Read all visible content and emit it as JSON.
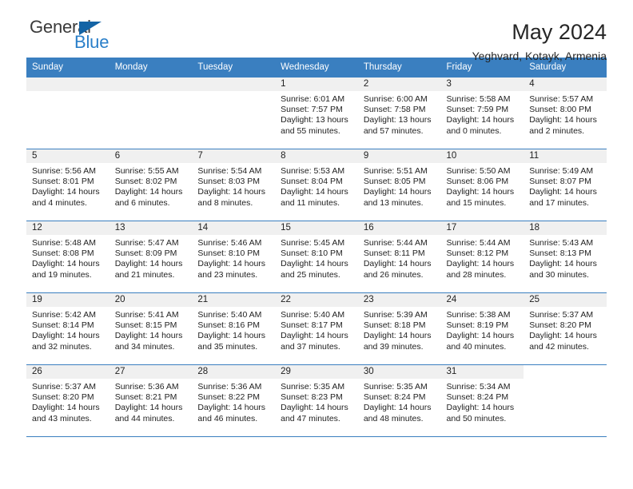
{
  "logo": {
    "word_one": "General",
    "word_two": "Blue",
    "triangle_color": "#1464a5",
    "blue_color": "#2a7fc9"
  },
  "header": {
    "title": "May 2024",
    "subtitle": "Yeghvard, Kotayk, Armenia"
  },
  "colors": {
    "header_band": "#3a7fc0",
    "daynum_band": "#f0f0f0",
    "text": "#1f1f1f"
  },
  "calendar": {
    "weekday_headers": [
      "Sunday",
      "Monday",
      "Tuesday",
      "Wednesday",
      "Thursday",
      "Friday",
      "Saturday"
    ],
    "labels": {
      "sunrise": "Sunrise:",
      "sunset": "Sunset:",
      "daylight": "Daylight:"
    },
    "weeks": [
      [
        {
          "day": "",
          "blank": false,
          "sunrise": "",
          "sunset": "",
          "daylight_1": "",
          "daylight_2": ""
        },
        {
          "day": "",
          "blank": false,
          "sunrise": "",
          "sunset": "",
          "daylight_1": "",
          "daylight_2": ""
        },
        {
          "day": "",
          "blank": false,
          "sunrise": "",
          "sunset": "",
          "daylight_1": "",
          "daylight_2": ""
        },
        {
          "day": "1",
          "blank": false,
          "sunrise": "Sunrise: 6:01 AM",
          "sunset": "Sunset: 7:57 PM",
          "daylight_1": "Daylight: 13 hours",
          "daylight_2": "and 55 minutes."
        },
        {
          "day": "2",
          "blank": false,
          "sunrise": "Sunrise: 6:00 AM",
          "sunset": "Sunset: 7:58 PM",
          "daylight_1": "Daylight: 13 hours",
          "daylight_2": "and 57 minutes."
        },
        {
          "day": "3",
          "blank": false,
          "sunrise": "Sunrise: 5:58 AM",
          "sunset": "Sunset: 7:59 PM",
          "daylight_1": "Daylight: 14 hours",
          "daylight_2": "and 0 minutes."
        },
        {
          "day": "4",
          "blank": false,
          "sunrise": "Sunrise: 5:57 AM",
          "sunset": "Sunset: 8:00 PM",
          "daylight_1": "Daylight: 14 hours",
          "daylight_2": "and 2 minutes."
        }
      ],
      [
        {
          "day": "5",
          "blank": false,
          "sunrise": "Sunrise: 5:56 AM",
          "sunset": "Sunset: 8:01 PM",
          "daylight_1": "Daylight: 14 hours",
          "daylight_2": "and 4 minutes."
        },
        {
          "day": "6",
          "blank": false,
          "sunrise": "Sunrise: 5:55 AM",
          "sunset": "Sunset: 8:02 PM",
          "daylight_1": "Daylight: 14 hours",
          "daylight_2": "and 6 minutes."
        },
        {
          "day": "7",
          "blank": false,
          "sunrise": "Sunrise: 5:54 AM",
          "sunset": "Sunset: 8:03 PM",
          "daylight_1": "Daylight: 14 hours",
          "daylight_2": "and 8 minutes."
        },
        {
          "day": "8",
          "blank": false,
          "sunrise": "Sunrise: 5:53 AM",
          "sunset": "Sunset: 8:04 PM",
          "daylight_1": "Daylight: 14 hours",
          "daylight_2": "and 11 minutes."
        },
        {
          "day": "9",
          "blank": false,
          "sunrise": "Sunrise: 5:51 AM",
          "sunset": "Sunset: 8:05 PM",
          "daylight_1": "Daylight: 14 hours",
          "daylight_2": "and 13 minutes."
        },
        {
          "day": "10",
          "blank": false,
          "sunrise": "Sunrise: 5:50 AM",
          "sunset": "Sunset: 8:06 PM",
          "daylight_1": "Daylight: 14 hours",
          "daylight_2": "and 15 minutes."
        },
        {
          "day": "11",
          "blank": false,
          "sunrise": "Sunrise: 5:49 AM",
          "sunset": "Sunset: 8:07 PM",
          "daylight_1": "Daylight: 14 hours",
          "daylight_2": "and 17 minutes."
        }
      ],
      [
        {
          "day": "12",
          "blank": false,
          "sunrise": "Sunrise: 5:48 AM",
          "sunset": "Sunset: 8:08 PM",
          "daylight_1": "Daylight: 14 hours",
          "daylight_2": "and 19 minutes."
        },
        {
          "day": "13",
          "blank": false,
          "sunrise": "Sunrise: 5:47 AM",
          "sunset": "Sunset: 8:09 PM",
          "daylight_1": "Daylight: 14 hours",
          "daylight_2": "and 21 minutes."
        },
        {
          "day": "14",
          "blank": false,
          "sunrise": "Sunrise: 5:46 AM",
          "sunset": "Sunset: 8:10 PM",
          "daylight_1": "Daylight: 14 hours",
          "daylight_2": "and 23 minutes."
        },
        {
          "day": "15",
          "blank": false,
          "sunrise": "Sunrise: 5:45 AM",
          "sunset": "Sunset: 8:10 PM",
          "daylight_1": "Daylight: 14 hours",
          "daylight_2": "and 25 minutes."
        },
        {
          "day": "16",
          "blank": false,
          "sunrise": "Sunrise: 5:44 AM",
          "sunset": "Sunset: 8:11 PM",
          "daylight_1": "Daylight: 14 hours",
          "daylight_2": "and 26 minutes."
        },
        {
          "day": "17",
          "blank": false,
          "sunrise": "Sunrise: 5:44 AM",
          "sunset": "Sunset: 8:12 PM",
          "daylight_1": "Daylight: 14 hours",
          "daylight_2": "and 28 minutes."
        },
        {
          "day": "18",
          "blank": false,
          "sunrise": "Sunrise: 5:43 AM",
          "sunset": "Sunset: 8:13 PM",
          "daylight_1": "Daylight: 14 hours",
          "daylight_2": "and 30 minutes."
        }
      ],
      [
        {
          "day": "19",
          "blank": false,
          "sunrise": "Sunrise: 5:42 AM",
          "sunset": "Sunset: 8:14 PM",
          "daylight_1": "Daylight: 14 hours",
          "daylight_2": "and 32 minutes."
        },
        {
          "day": "20",
          "blank": false,
          "sunrise": "Sunrise: 5:41 AM",
          "sunset": "Sunset: 8:15 PM",
          "daylight_1": "Daylight: 14 hours",
          "daylight_2": "and 34 minutes."
        },
        {
          "day": "21",
          "blank": false,
          "sunrise": "Sunrise: 5:40 AM",
          "sunset": "Sunset: 8:16 PM",
          "daylight_1": "Daylight: 14 hours",
          "daylight_2": "and 35 minutes."
        },
        {
          "day": "22",
          "blank": false,
          "sunrise": "Sunrise: 5:40 AM",
          "sunset": "Sunset: 8:17 PM",
          "daylight_1": "Daylight: 14 hours",
          "daylight_2": "and 37 minutes."
        },
        {
          "day": "23",
          "blank": false,
          "sunrise": "Sunrise: 5:39 AM",
          "sunset": "Sunset: 8:18 PM",
          "daylight_1": "Daylight: 14 hours",
          "daylight_2": "and 39 minutes."
        },
        {
          "day": "24",
          "blank": false,
          "sunrise": "Sunrise: 5:38 AM",
          "sunset": "Sunset: 8:19 PM",
          "daylight_1": "Daylight: 14 hours",
          "daylight_2": "and 40 minutes."
        },
        {
          "day": "25",
          "blank": false,
          "sunrise": "Sunrise: 5:37 AM",
          "sunset": "Sunset: 8:20 PM",
          "daylight_1": "Daylight: 14 hours",
          "daylight_2": "and 42 minutes."
        }
      ],
      [
        {
          "day": "26",
          "blank": false,
          "sunrise": "Sunrise: 5:37 AM",
          "sunset": "Sunset: 8:20 PM",
          "daylight_1": "Daylight: 14 hours",
          "daylight_2": "and 43 minutes."
        },
        {
          "day": "27",
          "blank": false,
          "sunrise": "Sunrise: 5:36 AM",
          "sunset": "Sunset: 8:21 PM",
          "daylight_1": "Daylight: 14 hours",
          "daylight_2": "and 44 minutes."
        },
        {
          "day": "28",
          "blank": false,
          "sunrise": "Sunrise: 5:36 AM",
          "sunset": "Sunset: 8:22 PM",
          "daylight_1": "Daylight: 14 hours",
          "daylight_2": "and 46 minutes."
        },
        {
          "day": "29",
          "blank": false,
          "sunrise": "Sunrise: 5:35 AM",
          "sunset": "Sunset: 8:23 PM",
          "daylight_1": "Daylight: 14 hours",
          "daylight_2": "and 47 minutes."
        },
        {
          "day": "30",
          "blank": false,
          "sunrise": "Sunrise: 5:35 AM",
          "sunset": "Sunset: 8:24 PM",
          "daylight_1": "Daylight: 14 hours",
          "daylight_2": "and 48 minutes."
        },
        {
          "day": "31",
          "blank": false,
          "sunrise": "Sunrise: 5:34 AM",
          "sunset": "Sunset: 8:24 PM",
          "daylight_1": "Daylight: 14 hours",
          "daylight_2": "and 50 minutes."
        },
        {
          "day": "",
          "blank": true,
          "sunrise": "",
          "sunset": "",
          "daylight_1": "",
          "daylight_2": ""
        }
      ]
    ]
  }
}
